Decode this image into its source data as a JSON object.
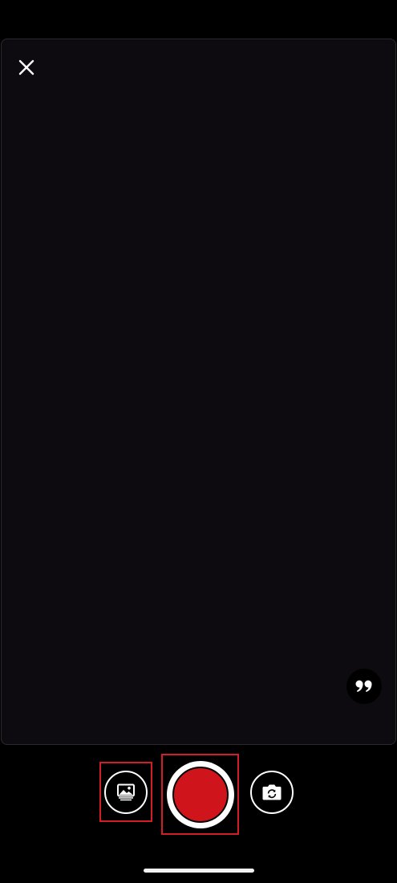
{
  "camera": {
    "close_icon": "close-icon",
    "quote_icon": "quote-icon",
    "gallery_icon": "gallery-icon",
    "flip_icon": "camera-flip-icon"
  },
  "colors": {
    "background": "#000000",
    "viewfinder": "#0d0b0f",
    "record_red": "#d0141b",
    "highlight_outline": "#d21f27",
    "icon_white": "#ffffff"
  }
}
